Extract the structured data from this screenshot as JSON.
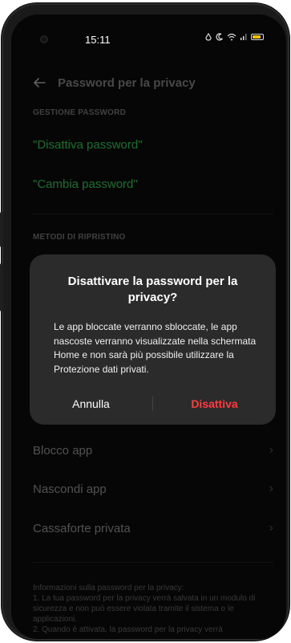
{
  "status_bar": {
    "time": "15:11",
    "icons": [
      "alarm-icon",
      "moon-icon",
      "wifi-icon",
      "signal-icon",
      "battery-icon"
    ],
    "battery_color": "#f2c200"
  },
  "header": {
    "title": "Password per la privacy"
  },
  "sections": {
    "password_management": {
      "header": "GESTIONE PASSWORD",
      "items": [
        {
          "label": "\"Disattiva password\""
        },
        {
          "label": "\"Cambia password\""
        }
      ]
    },
    "recovery": {
      "header": "METODI DI RIPRISTINO"
    },
    "features": {
      "items": [
        {
          "label": "Blocco app"
        },
        {
          "label": "Nascondi app"
        },
        {
          "label": "Cassaforte privata"
        }
      ]
    }
  },
  "footer": {
    "text": "Informazioni sulla password per la privacy:\n1. La tua password per la privacy verrà salvata in un modulo di sicurezza e non può essere violata tramite il sistema o le applicazioni.\n2. Quando è attivata, la password per la privacy verrà"
  },
  "dialog": {
    "title": "Disattivare la password per la privacy?",
    "message": "Le app bloccate verranno sbloccate, le app nascoste verranno visualizzate nella schermata Home e non sarà più possibile utilizzare la Protezione dati privati.",
    "cancel_label": "Annulla",
    "confirm_label": "Disattiva"
  },
  "colors": {
    "accent_green": "#2fd35f",
    "danger_red": "#ff3b40",
    "dialog_bg": "#2b2b2b"
  }
}
